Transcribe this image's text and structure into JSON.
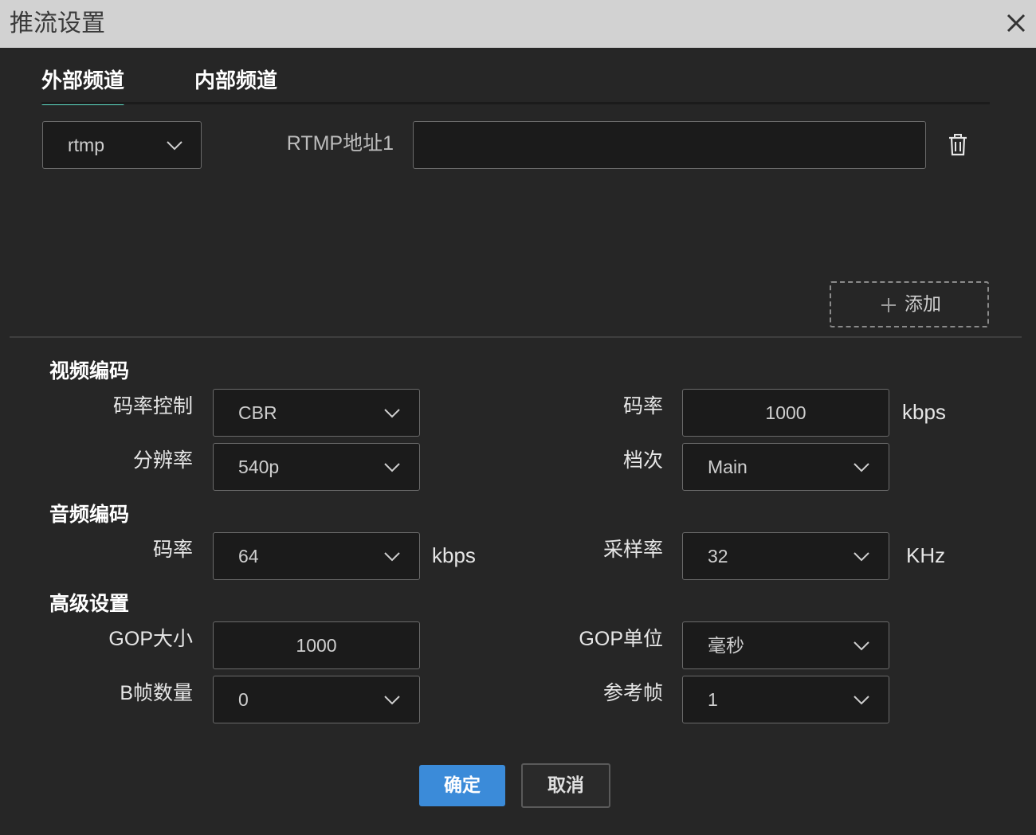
{
  "window": {
    "title": "推流设置"
  },
  "tabs": [
    {
      "label": "外部频道",
      "active": true
    },
    {
      "label": "内部频道",
      "active": false
    }
  ],
  "stream": {
    "protocol": "rtmp",
    "address_label": "RTMP地址1",
    "address_value": "",
    "add_label": "添加"
  },
  "video": {
    "section_title": "视频编码",
    "rate_control_label": "码率控制",
    "rate_control_value": "CBR",
    "bitrate_label": "码率",
    "bitrate_value": "1000",
    "bitrate_unit": "kbps",
    "resolution_label": "分辨率",
    "resolution_value": "540p",
    "profile_label": "档次",
    "profile_value": "Main"
  },
  "audio": {
    "section_title": "音频编码",
    "bitrate_label": "码率",
    "bitrate_value": "64",
    "bitrate_unit": "kbps",
    "samplerate_label": "采样率",
    "samplerate_value": "32",
    "samplerate_unit": "KHz"
  },
  "advanced": {
    "section_title": "高级设置",
    "gop_size_label": "GOP大小",
    "gop_size_value": "1000",
    "gop_unit_label": "GOP单位",
    "gop_unit_value": "毫秒",
    "bframes_label": "B帧数量",
    "bframes_value": "0",
    "ref_frames_label": "参考帧",
    "ref_frames_value": "1"
  },
  "footer": {
    "ok_label": "确定",
    "cancel_label": "取消"
  },
  "colors": {
    "accent_tab": "#5fe0c9",
    "primary_button": "#3b8bd9",
    "background": "#262626"
  }
}
